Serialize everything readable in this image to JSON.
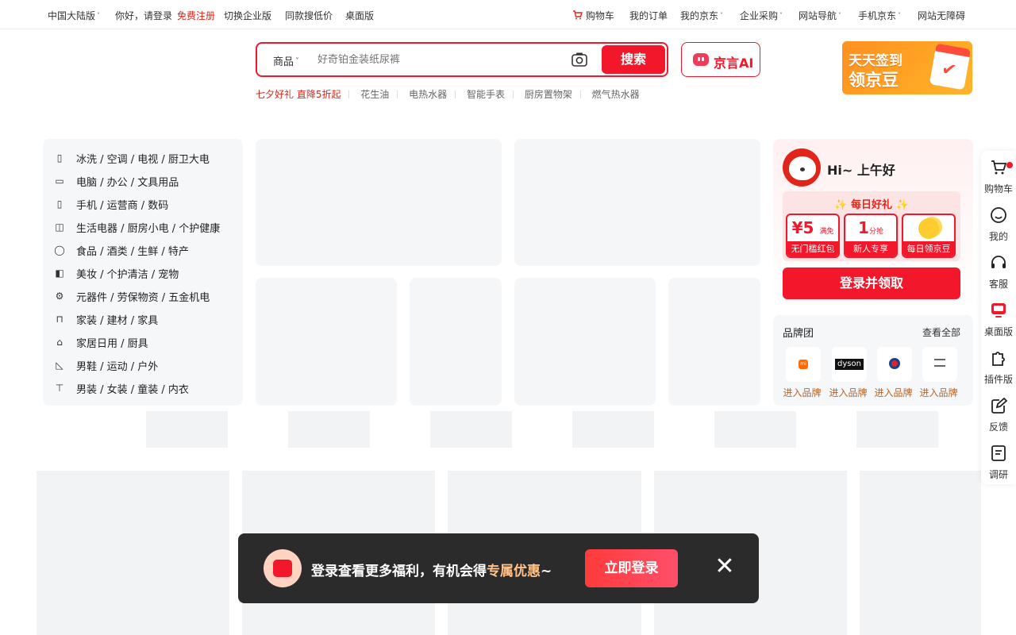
{
  "topbar": {
    "region": "中国大陆版",
    "greeting": "你好，请登录",
    "register": "免费注册",
    "enterprise_switch": "切换企业版",
    "same_style": "同款搜低价",
    "desktop": "桌面版",
    "cart": "购物车",
    "orders": "我的订单",
    "my_jd": "我的京东",
    "enterprise_purchase": "企业采购",
    "site_nav": "网站导航",
    "mobile_jd": "手机京东",
    "accessibility": "网站无障碍"
  },
  "search": {
    "category": "商品",
    "placeholder": "好奇铂金装纸尿裤",
    "button": "搜索"
  },
  "ai_button": "京言AI",
  "hotwords": [
    "七夕好礼 直降5折起",
    "花生油",
    "电热水器",
    "智能手表",
    "厨房置物架",
    "燃气热水器"
  ],
  "signin_banner": {
    "line1": "天天签到",
    "line2": "领京豆"
  },
  "categories": [
    {
      "icon": "fridge-icon",
      "label": "冰洗 / 空调 / 电视 / 厨卫大电"
    },
    {
      "icon": "monitor-icon",
      "label": "电脑 / 办公 / 文具用品"
    },
    {
      "icon": "phone-icon",
      "label": "手机 / 运营商 / 数码"
    },
    {
      "icon": "appliance-icon",
      "label": "生活电器 / 厨房小电 / 个护健康"
    },
    {
      "icon": "apple-icon",
      "label": "食品 / 酒类 / 生鲜 / 特产"
    },
    {
      "icon": "cosmetics-icon",
      "label": "美妆 / 个护清洁 / 宠物"
    },
    {
      "icon": "gear-icon",
      "label": "元器件 / 劳保物资 / 五金机电"
    },
    {
      "icon": "chair-icon",
      "label": "家装 / 建材 / 家具"
    },
    {
      "icon": "home-icon",
      "label": "家居日用 / 厨具"
    },
    {
      "icon": "shoe-icon",
      "label": "男鞋 / 运动 / 户外"
    },
    {
      "icon": "shirt-icon",
      "label": "男装 / 女装 / 童装 / 内衣"
    }
  ],
  "user_card": {
    "greeting": "Hi~ 上午好",
    "daily_gift_title": "每日好礼",
    "gifts": [
      {
        "value": "¥5",
        "unit": "满免",
        "label": "无门槛红包"
      },
      {
        "value": "1",
        "unit": "分抢",
        "label": "新人专享"
      },
      {
        "value": "",
        "unit": "",
        "label": "每日领京豆"
      }
    ],
    "login_button": "登录并领取"
  },
  "brand_group": {
    "title": "品牌团",
    "view_all": "查看全部",
    "items": [
      {
        "logo": "mi",
        "label": "进入品牌"
      },
      {
        "logo": "dyson",
        "label": "进入品牌"
      },
      {
        "logo": "",
        "label": "进入品牌"
      },
      {
        "logo": "",
        "label": "进入品牌"
      }
    ]
  },
  "right_rail": [
    {
      "icon": "cart-icon",
      "label": "购物车"
    },
    {
      "icon": "smile-icon",
      "label": "我的"
    },
    {
      "icon": "headset-icon",
      "label": "客服"
    },
    {
      "icon": "desktop-icon",
      "label": "桌面版"
    },
    {
      "icon": "plugin-icon",
      "label": "插件版"
    },
    {
      "icon": "feedback-icon",
      "label": "反馈"
    },
    {
      "icon": "survey-icon",
      "label": "调研"
    }
  ],
  "toast": {
    "message_prefix": "登录查看更多福利，有机会得",
    "message_highlight": "专属优惠",
    "message_suffix": "~",
    "button": "立即登录"
  },
  "colors": {
    "brand_red": "#f2172a",
    "toast_bg": "#2b2b2b",
    "brand_gold": "#b8652a"
  }
}
